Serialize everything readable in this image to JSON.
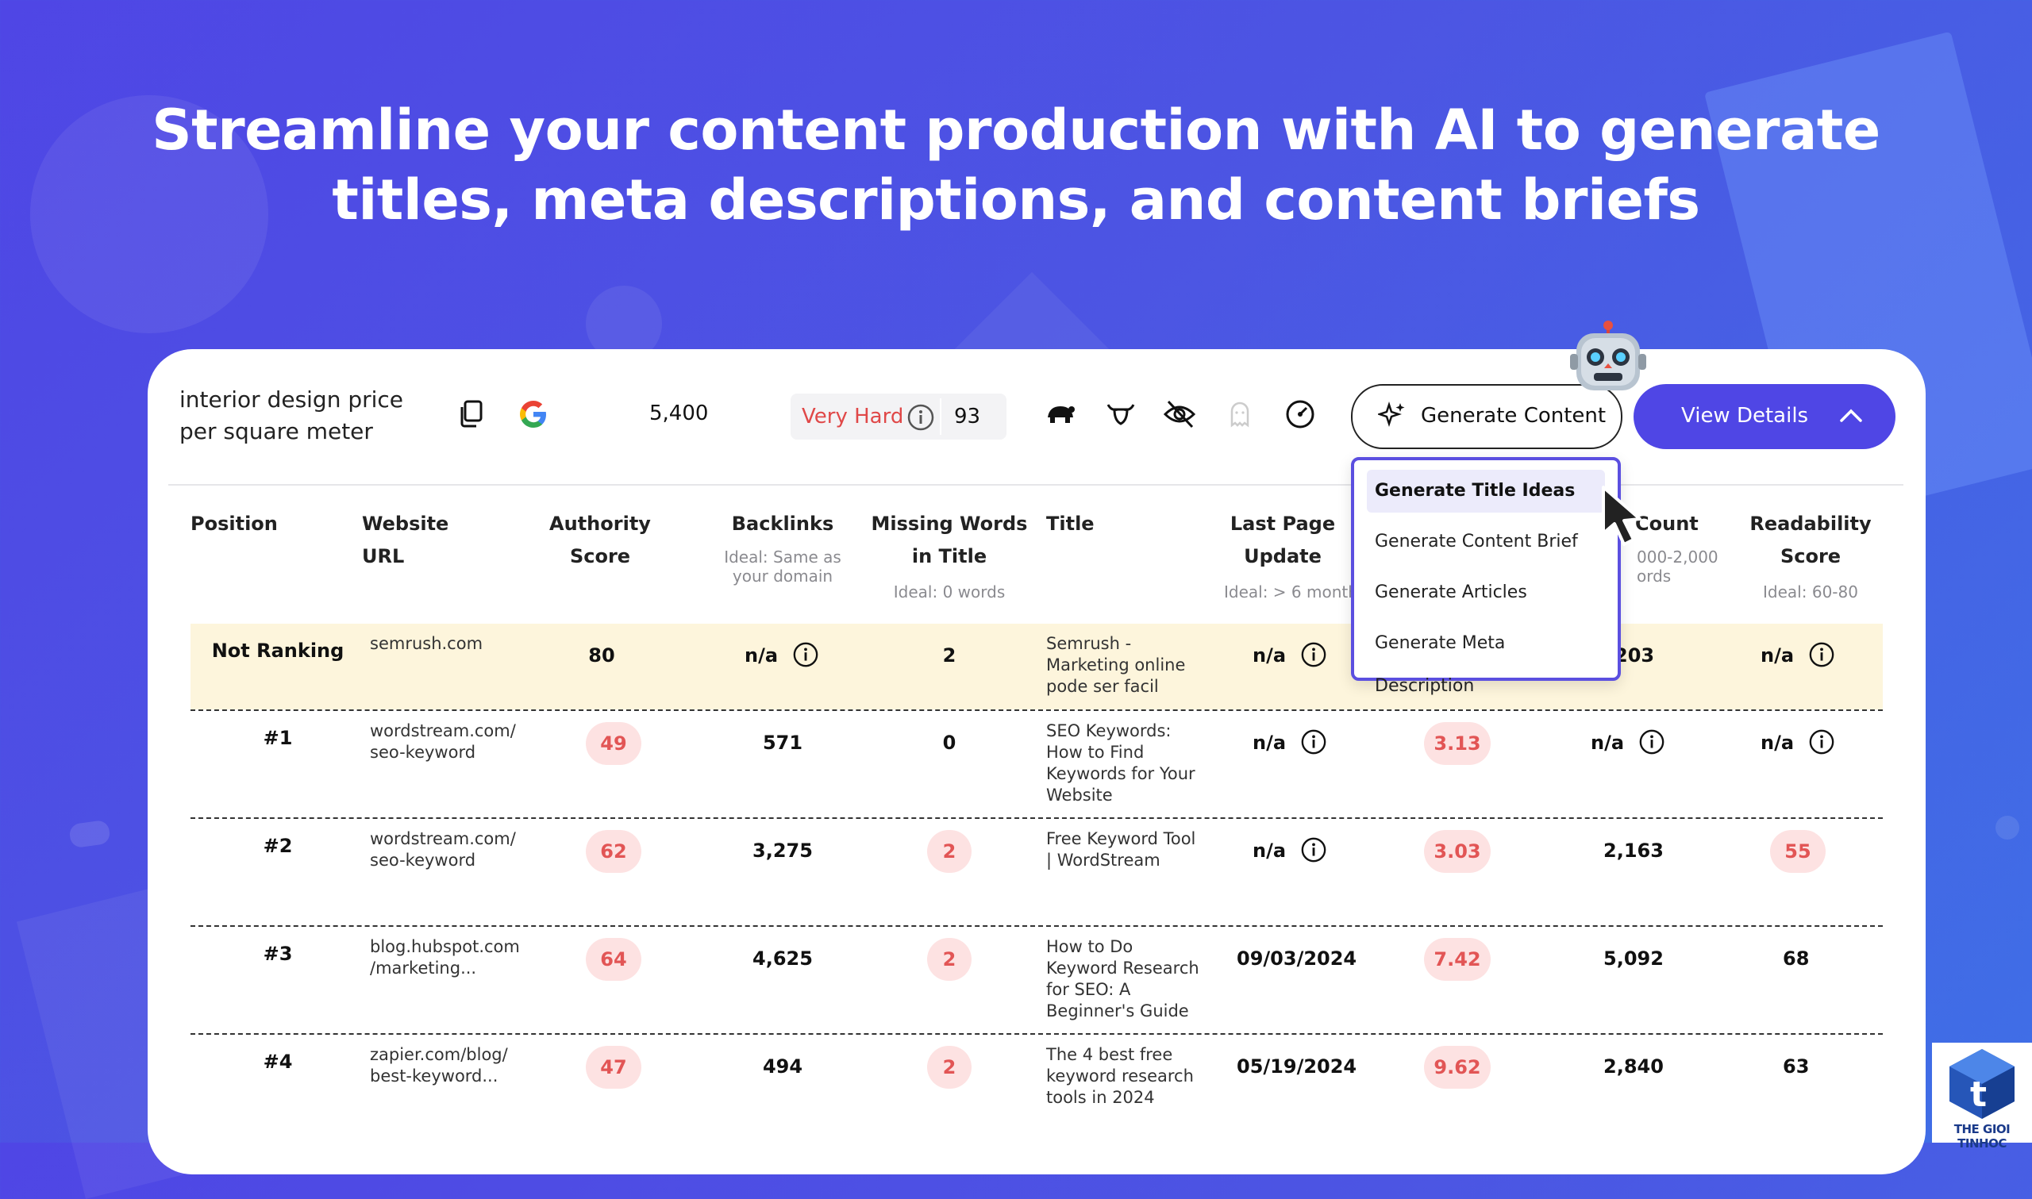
{
  "headline": {
    "line1": "Streamline your content production with AI to generate",
    "line2": "titles, meta descriptions, and content briefs"
  },
  "toolbar": {
    "keyword": "interior design price per square meter",
    "volume": "5,400",
    "difficulty_label": "Very Hard",
    "difficulty_value": "93",
    "generate_label": "Generate Content",
    "view_details_label": "View Details"
  },
  "dropdown": {
    "items": [
      "Generate Title Ideas",
      "Generate Content Brief",
      "Generate Articles",
      "Generate Meta Description"
    ],
    "active_index": 0
  },
  "table": {
    "headers": {
      "position": "Position",
      "website": [
        "Website",
        "URL"
      ],
      "authority": [
        "Authority",
        "Score"
      ],
      "backlinks": "Backlinks",
      "backlinks_sub": [
        "Ideal: Same as",
        "your domain"
      ],
      "missing": [
        "Missing Words",
        "in Title"
      ],
      "missing_sub": "Ideal: 0 words",
      "title": "Title",
      "last_update": [
        "Last Page",
        "Update"
      ],
      "last_update_sub": "Ideal: > 6 month",
      "count": "Count",
      "count_sub": [
        "000-2,000",
        "ords"
      ],
      "readability": [
        "Readability",
        "Score"
      ],
      "readability_sub": "Ideal: 60-80"
    },
    "rows": [
      {
        "position": "Not Ranking",
        "url": [
          "semrush.com"
        ],
        "authority": "80",
        "backlinks": "n/a",
        "missing": "2",
        "title": [
          "Semrush -",
          "Marketing online",
          "pode ser facil"
        ],
        "last_update": "n/a",
        "col8": "",
        "count": "203",
        "readability": "n/a"
      },
      {
        "position": "#1",
        "url": [
          "wordstream.com/",
          "seo-keyword"
        ],
        "authority": "49",
        "backlinks": "571",
        "missing": "0",
        "title": [
          "SEO Keywords:",
          "How to Find",
          "Keywords for Your",
          "Website"
        ],
        "last_update": "n/a",
        "col8": "3.13",
        "count": "n/a",
        "readability": "n/a"
      },
      {
        "position": "#2",
        "url": [
          "wordstream.com/",
          "seo-keyword"
        ],
        "authority": "62",
        "backlinks": "3,275",
        "missing": "2",
        "title": [
          "Free Keyword Tool",
          "| WordStream"
        ],
        "last_update": "n/a",
        "col8": "3.03",
        "count": "2,163",
        "readability": "55"
      },
      {
        "position": "#3",
        "url": [
          "blog.hubspot.com",
          "/marketing..."
        ],
        "authority": "64",
        "backlinks": "4,625",
        "missing": "2",
        "title": [
          "How to Do",
          "Keyword Research",
          "for SEO: A",
          "Beginner's Guide"
        ],
        "last_update": "09/03/2024",
        "col8": "7.42",
        "count": "5,092",
        "readability": "68"
      },
      {
        "position": "#4",
        "url": [
          "zapier.com/blog/",
          "best-keyword..."
        ],
        "authority": "47",
        "backlinks": "494",
        "missing": "2",
        "title": [
          "The 4 best free",
          "keyword research",
          "tools in 2024"
        ],
        "last_update": "05/19/2024",
        "col8": "9.62",
        "count": "2,840",
        "readability": "63"
      }
    ]
  },
  "watermark": "THE GIOI TINHOC",
  "colors": {
    "accent": "#4f46e5",
    "danger": "#e25555",
    "danger_bg": "#fde2e2",
    "highlight_row": "#fdf5dc"
  }
}
